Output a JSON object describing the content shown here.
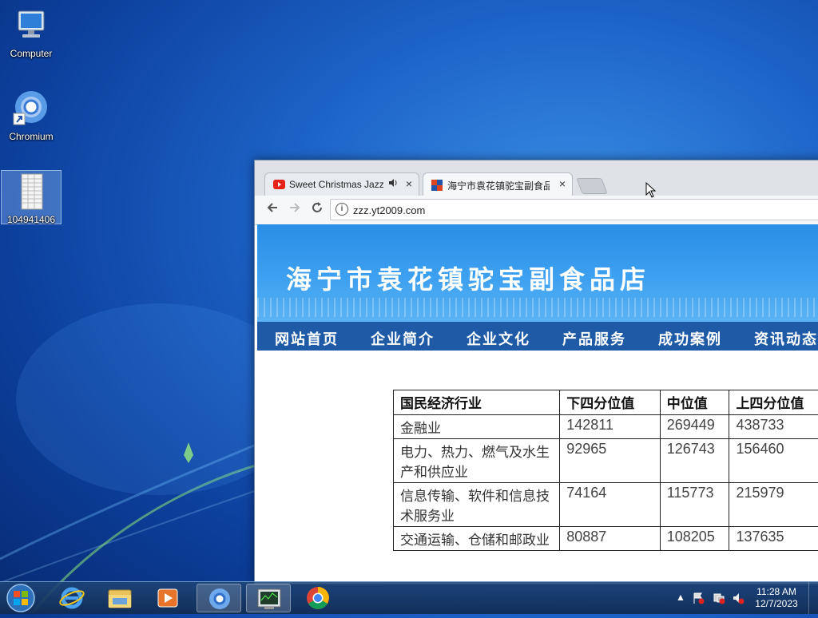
{
  "desktop": {
    "icons": [
      {
        "label": "Computer",
        "icon": "computer-icon"
      },
      {
        "label": "Chromium",
        "icon": "chromium-icon"
      },
      {
        "label": "104941406",
        "icon": "spreadsheet-file-icon"
      }
    ]
  },
  "browser": {
    "tabs": [
      {
        "label": "Sweet Christmas Jazz",
        "icon": "youtube-icon",
        "audio_icon": "speaker-icon",
        "close": "×"
      },
      {
        "label": "海宁市袁花镇驼宝副食品店",
        "icon": "site-favicon",
        "close": "×"
      }
    ],
    "address": {
      "url": "zzz.yt2009.com"
    },
    "site": {
      "title": "海宁市袁花镇驼宝副食品店",
      "nav": [
        "网站首页",
        "企业简介",
        "企业文化",
        "产品服务",
        "成功案例",
        "资讯动态"
      ],
      "table": {
        "headers": [
          "国民经济行业",
          "下四分位值",
          "中位值",
          "上四分位值"
        ],
        "rows": [
          [
            "金融业",
            "142811",
            "269449",
            "438733"
          ],
          [
            "电力、热力、燃气及水生产和供应业",
            "92965",
            "126743",
            "156460"
          ],
          [
            "信息传输、软件和信息技术服务业",
            "74164",
            "115773",
            "215979"
          ],
          [
            "交通运输、仓储和邮政业",
            "80887",
            "108205",
            "137635"
          ]
        ]
      }
    }
  },
  "taskbar": {
    "apps": [
      "start-button",
      "internet-explorer",
      "file-explorer",
      "media-player",
      "chromium",
      "task-manager",
      "chrome"
    ],
    "clock": {
      "time": "11:28 AM",
      "date": "12/7/2023"
    }
  }
}
